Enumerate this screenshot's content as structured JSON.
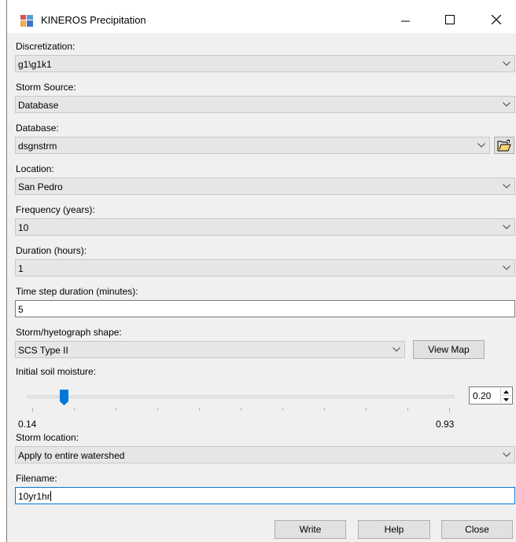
{
  "window": {
    "title": "KINEROS Precipitation",
    "icon": "app-window-icon",
    "controls": {
      "minimize": "minimize-icon",
      "maximize": "maximize-icon",
      "close": "close-icon"
    }
  },
  "discretization": {
    "label": "Discretization:",
    "value": "g1\\g1k1"
  },
  "storm_source": {
    "label": "Storm Source:",
    "value": "Database"
  },
  "database": {
    "label": "Database:",
    "value": "dsgnstrm",
    "browse_icon": "open-folder-icon"
  },
  "location": {
    "label": "Location:",
    "value": "San Pedro"
  },
  "frequency": {
    "label": "Frequency (years):",
    "value": "10"
  },
  "duration": {
    "label": "Duration (hours):",
    "value": "1"
  },
  "time_step": {
    "label": "Time step duration (minutes):",
    "value": "5"
  },
  "storm_shape": {
    "label": "Storm/hyetograph shape:",
    "value": "SCS Type II",
    "view_map_label": "View Map"
  },
  "soil_moisture": {
    "label": "Initial soil moisture:",
    "min_label": "0.14",
    "max_label": "0.93",
    "min": 0.14,
    "max": 0.93,
    "value": 0.2,
    "value_text": "0.20"
  },
  "storm_location": {
    "label": "Storm location:",
    "value": "Apply to entire watershed"
  },
  "filename": {
    "label": "Filename:",
    "value": "10yr1hr"
  },
  "buttons": {
    "write": "Write",
    "help": "Help",
    "close": "Close"
  },
  "colors": {
    "accent": "#0078d7",
    "window_bg": "#f0f0f0",
    "combo_bg": "#e6e6e6"
  }
}
